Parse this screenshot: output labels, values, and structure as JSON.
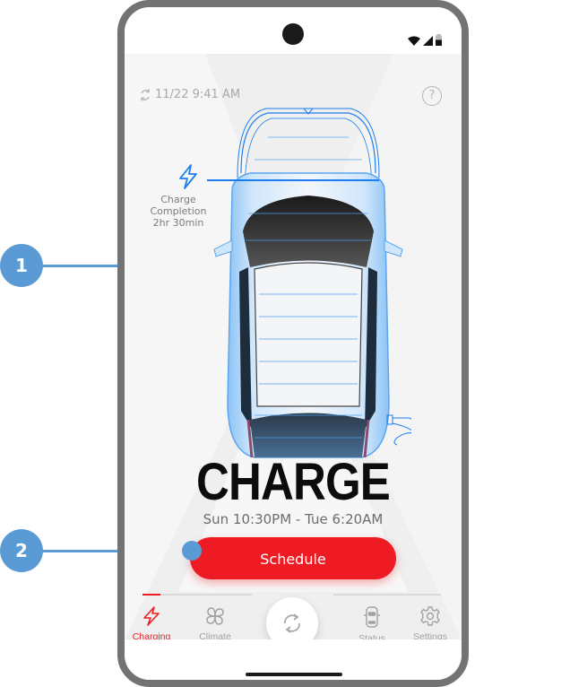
{
  "status_bar": {
    "icons": [
      "wifi-icon",
      "cellular-signal-icon",
      "battery-icon"
    ]
  },
  "header": {
    "sync_icon": "sync-icon",
    "last_updated": "11/22 9:41 AM",
    "help_label": "?"
  },
  "charge_indicator": {
    "icon": "lightning-bolt-icon",
    "line1": "Charge",
    "line2": "Completion",
    "line3": "2hr 30min"
  },
  "main": {
    "title": "CHARGE",
    "time_range": "Sun 10:30PM - Tue 6:20AM",
    "schedule_button": "Schedule"
  },
  "tabs": [
    {
      "label": "Charging",
      "icon": "lightning-bolt-icon",
      "active": true
    },
    {
      "label": "Climate",
      "icon": "fan-icon",
      "active": false
    },
    {
      "label": "Status",
      "icon": "car-top-icon",
      "active": false
    },
    {
      "label": "Settings",
      "icon": "gear-icon",
      "active": false
    }
  ],
  "center_button": {
    "icon": "refresh-icon"
  },
  "callouts": [
    {
      "number": "1"
    },
    {
      "number": "2"
    }
  ],
  "colors": {
    "accent_red": "#ee1b24",
    "outline_blue": "#1a7ef0",
    "callout_blue": "#5b9bd5",
    "bezel_gray": "#737373"
  }
}
